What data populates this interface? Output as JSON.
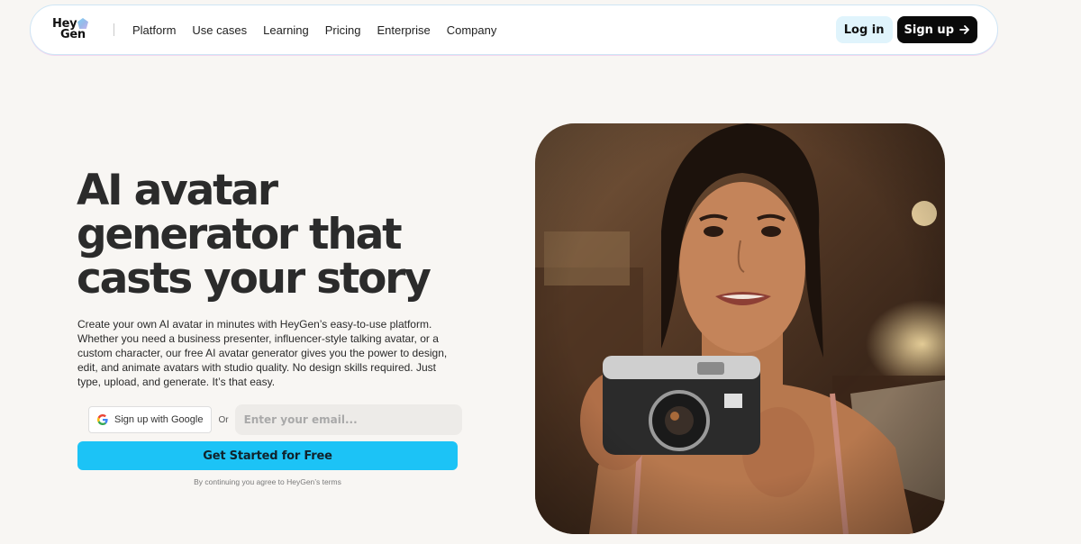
{
  "brand": {
    "logo_line1": "Hey",
    "logo_line2": "Gen"
  },
  "nav": {
    "links": [
      "Platform",
      "Use cases",
      "Learning",
      "Pricing",
      "Enterprise",
      "Company"
    ],
    "login_label": "Log in",
    "signup_label": "Sign up"
  },
  "hero": {
    "title_line1": "AI avatar",
    "title_line2": "generator that",
    "title_line3": "casts your story",
    "description": "Create your own AI avatar in minutes with HeyGen’s easy-to-use platform. Whether you need a business presenter, influencer-style talking avatar, or a custom character, our free AI avatar generator gives you the power to design, edit, and animate avatars with studio quality. No design skills required. Just type, upload, and generate. It’s that easy.",
    "google_button_label": "Sign up with Google",
    "or_label": "Or",
    "email_placeholder": "Enter your email...",
    "cta_label": "Get Started for Free",
    "terms_text": "By continuing you agree to HeyGen’s terms"
  },
  "icons": {
    "logo": "heygen-gem-icon",
    "google": "google-icon",
    "arrow": "arrow-right-icon"
  },
  "colors": {
    "page_background": "#f8f6f3",
    "cta_background": "#1cc3f6",
    "login_background": "#e0f4fc",
    "signup_background": "#0a0a0a"
  }
}
